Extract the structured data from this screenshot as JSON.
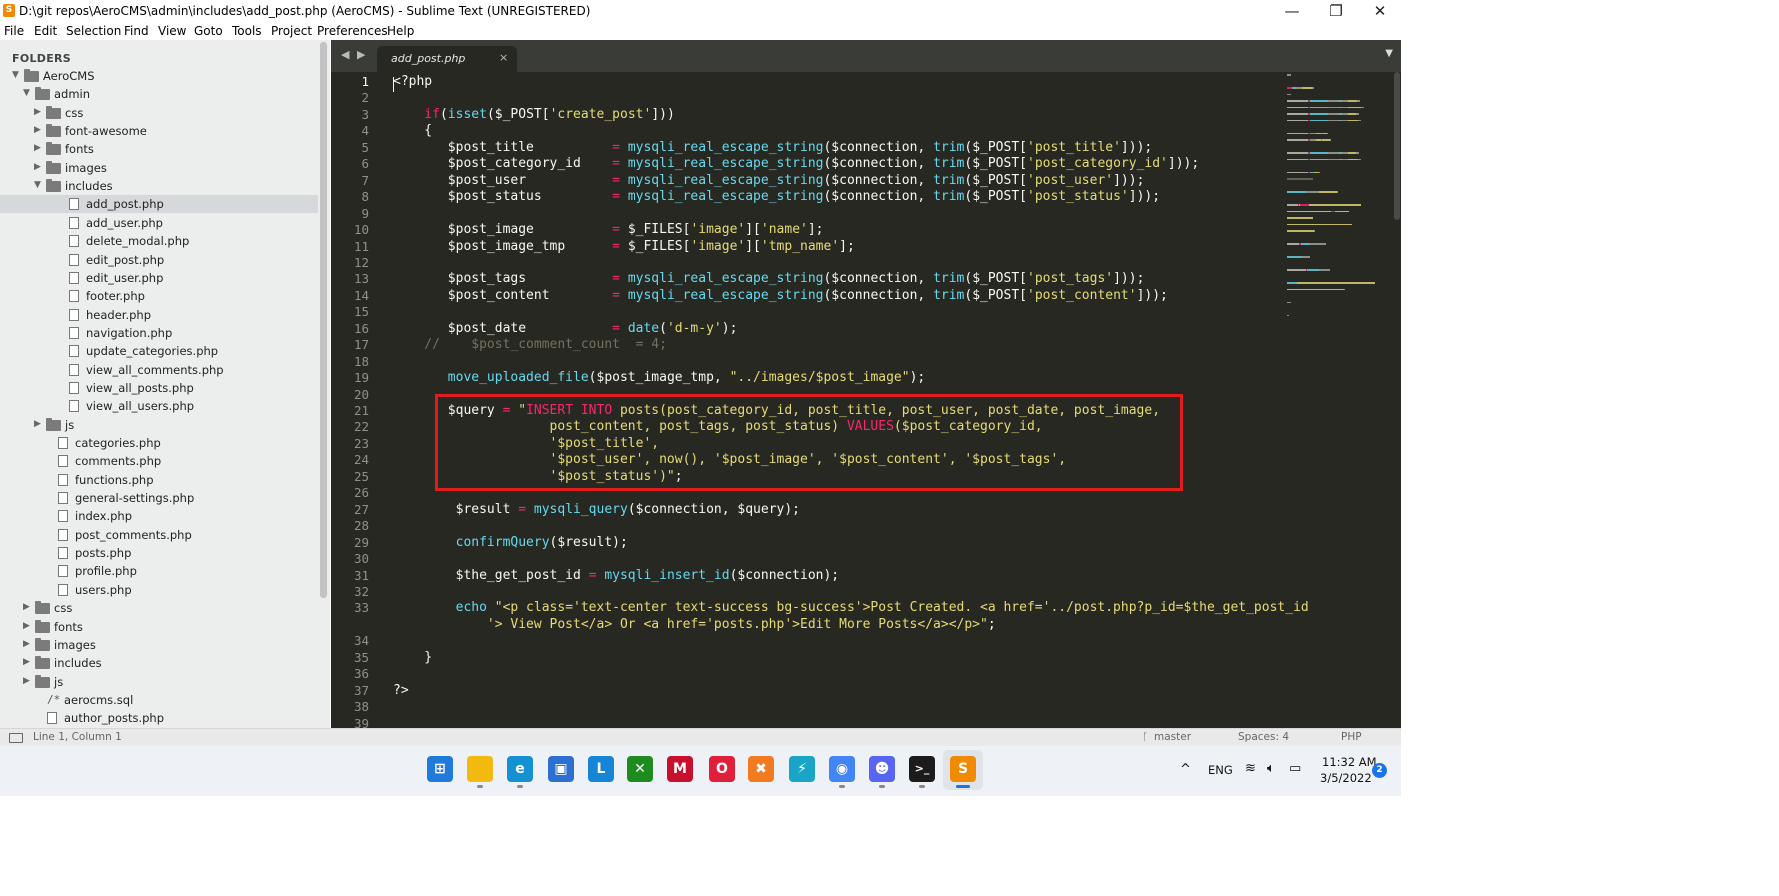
{
  "window": {
    "title": "D:\\git repos\\AeroCMS\\admin\\includes\\add_post.php (AeroCMS) - Sublime Text (UNREGISTERED)",
    "app_icon": "sublime-text-icon",
    "controls": {
      "minimize": "—",
      "maximize": "❐",
      "close": "✕"
    }
  },
  "menu": [
    "File",
    "Edit",
    "Selection",
    "Find",
    "View",
    "Goto",
    "Tools",
    "Project",
    "Preferences",
    "Help"
  ],
  "sidebar": {
    "header": "FOLDERS",
    "tree": [
      {
        "label": "AeroCMS",
        "type": "folder",
        "open": true
      },
      {
        "label": "admin",
        "type": "folder",
        "open": true
      },
      {
        "label": "css",
        "type": "folder",
        "open": false
      },
      {
        "label": "font-awesome",
        "type": "folder",
        "open": false
      },
      {
        "label": "fonts",
        "type": "folder",
        "open": false
      },
      {
        "label": "images",
        "type": "folder",
        "open": false
      },
      {
        "label": "includes",
        "type": "folder",
        "open": true
      },
      {
        "label": "add_post.php",
        "type": "file",
        "selected": true
      },
      {
        "label": "add_user.php",
        "type": "file"
      },
      {
        "label": "delete_modal.php",
        "type": "file"
      },
      {
        "label": "edit_post.php",
        "type": "file"
      },
      {
        "label": "edit_user.php",
        "type": "file"
      },
      {
        "label": "footer.php",
        "type": "file"
      },
      {
        "label": "header.php",
        "type": "file"
      },
      {
        "label": "navigation.php",
        "type": "file"
      },
      {
        "label": "update_categories.php",
        "type": "file"
      },
      {
        "label": "view_all_comments.php",
        "type": "file"
      },
      {
        "label": "view_all_posts.php",
        "type": "file"
      },
      {
        "label": "view_all_users.php",
        "type": "file"
      },
      {
        "label": "js",
        "type": "folder",
        "open": false
      },
      {
        "label": "categories.php",
        "type": "file"
      },
      {
        "label": "comments.php",
        "type": "file"
      },
      {
        "label": "functions.php",
        "type": "file"
      },
      {
        "label": "general-settings.php",
        "type": "file"
      },
      {
        "label": "index.php",
        "type": "file"
      },
      {
        "label": "post_comments.php",
        "type": "file"
      },
      {
        "label": "posts.php",
        "type": "file"
      },
      {
        "label": "profile.php",
        "type": "file"
      },
      {
        "label": "users.php",
        "type": "file"
      },
      {
        "label": "css",
        "type": "folder",
        "open": false
      },
      {
        "label": "fonts",
        "type": "folder",
        "open": false
      },
      {
        "label": "images",
        "type": "folder",
        "open": false
      },
      {
        "label": "includes",
        "type": "folder",
        "open": false
      },
      {
        "label": "js",
        "type": "folder",
        "open": false
      },
      {
        "label": "aerocms.sql",
        "type": "sql"
      },
      {
        "label": "author_posts.php",
        "type": "file"
      }
    ]
  },
  "editor": {
    "tab": {
      "label": "add_post.php",
      "close": "×",
      "nav": "◀ ▶",
      "dropdown": "▼"
    },
    "current_line": 1,
    "lines": [
      {
        "n": "1",
        "segs": [
          [
            "p",
            "<?php"
          ]
        ]
      },
      {
        "n": "2",
        "segs": []
      },
      {
        "n": "3",
        "segs": [
          [
            "k",
            "    if"
          ],
          [
            "p",
            "("
          ],
          [
            "f",
            "isset"
          ],
          [
            "p",
            "($_POST["
          ],
          [
            "s",
            "'create_post'"
          ],
          [
            "p",
            "]))"
          ]
        ]
      },
      {
        "n": "4",
        "segs": [
          [
            "p",
            "    {"
          ]
        ]
      },
      {
        "n": "5",
        "segs": [
          [
            "v",
            "       $post_title          "
          ],
          [
            "k",
            "= "
          ],
          [
            "f",
            "mysqli_real_escape_string"
          ],
          [
            "p",
            "($connection, "
          ],
          [
            "f",
            "trim"
          ],
          [
            "p",
            "($_POST["
          ],
          [
            "s",
            "'post_title'"
          ],
          [
            "p",
            "]));"
          ]
        ]
      },
      {
        "n": "6",
        "segs": [
          [
            "v",
            "       $post_category_id    "
          ],
          [
            "k",
            "= "
          ],
          [
            "f",
            "mysqli_real_escape_string"
          ],
          [
            "p",
            "($connection, "
          ],
          [
            "f",
            "trim"
          ],
          [
            "p",
            "($_POST["
          ],
          [
            "s",
            "'post_category_id'"
          ],
          [
            "p",
            "]));"
          ]
        ]
      },
      {
        "n": "7",
        "segs": [
          [
            "v",
            "       $post_user           "
          ],
          [
            "k",
            "= "
          ],
          [
            "f",
            "mysqli_real_escape_string"
          ],
          [
            "p",
            "($connection, "
          ],
          [
            "f",
            "trim"
          ],
          [
            "p",
            "($_POST["
          ],
          [
            "s",
            "'post_user'"
          ],
          [
            "p",
            "]));"
          ]
        ]
      },
      {
        "n": "8",
        "segs": [
          [
            "v",
            "       $post_status         "
          ],
          [
            "k",
            "= "
          ],
          [
            "f",
            "mysqli_real_escape_string"
          ],
          [
            "p",
            "($connection, "
          ],
          [
            "f",
            "trim"
          ],
          [
            "p",
            "($_POST["
          ],
          [
            "s",
            "'post_status'"
          ],
          [
            "p",
            "]));"
          ]
        ]
      },
      {
        "n": "9",
        "segs": []
      },
      {
        "n": "10",
        "segs": [
          [
            "v",
            "       $post_image          "
          ],
          [
            "k",
            "= "
          ],
          [
            "p",
            "$_FILES["
          ],
          [
            "s",
            "'image'"
          ],
          [
            "p",
            "]["
          ],
          [
            "s",
            "'name'"
          ],
          [
            "p",
            "];"
          ]
        ]
      },
      {
        "n": "11",
        "segs": [
          [
            "v",
            "       $post_image_tmp      "
          ],
          [
            "k",
            "= "
          ],
          [
            "p",
            "$_FILES["
          ],
          [
            "s",
            "'image'"
          ],
          [
            "p",
            "]["
          ],
          [
            "s",
            "'tmp_name'"
          ],
          [
            "p",
            "];"
          ]
        ]
      },
      {
        "n": "12",
        "segs": []
      },
      {
        "n": "13",
        "segs": [
          [
            "v",
            "       $post_tags           "
          ],
          [
            "k",
            "= "
          ],
          [
            "f",
            "mysqli_real_escape_string"
          ],
          [
            "p",
            "($connection, "
          ],
          [
            "f",
            "trim"
          ],
          [
            "p",
            "($_POST["
          ],
          [
            "s",
            "'post_tags'"
          ],
          [
            "p",
            "]));"
          ]
        ]
      },
      {
        "n": "14",
        "segs": [
          [
            "v",
            "       $post_content        "
          ],
          [
            "k",
            "= "
          ],
          [
            "f",
            "mysqli_real_escape_string"
          ],
          [
            "p",
            "($connection, "
          ],
          [
            "f",
            "trim"
          ],
          [
            "p",
            "($_POST["
          ],
          [
            "s",
            "'post_content'"
          ],
          [
            "p",
            "]));"
          ]
        ]
      },
      {
        "n": "15",
        "segs": []
      },
      {
        "n": "16",
        "segs": [
          [
            "v",
            "       $post_date           "
          ],
          [
            "k",
            "= "
          ],
          [
            "f",
            "date"
          ],
          [
            "p",
            "("
          ],
          [
            "s",
            "'d-m-y'"
          ],
          [
            "p",
            ");"
          ]
        ]
      },
      {
        "n": "17",
        "segs": [
          [
            "c",
            "    //    $post_comment_count  = 4;"
          ]
        ]
      },
      {
        "n": "18",
        "segs": []
      },
      {
        "n": "19",
        "segs": [
          [
            "f",
            "       move_uploaded_file"
          ],
          [
            "p",
            "($post_image_tmp, "
          ],
          [
            "s",
            "\"../images/$post_image\""
          ],
          [
            "p",
            ");"
          ]
        ]
      },
      {
        "n": "20",
        "segs": []
      },
      {
        "n": "21",
        "segs": [
          [
            "v",
            "       $query "
          ],
          [
            "k",
            "= "
          ],
          [
            "s",
            "\""
          ],
          [
            "k",
            "INSERT INTO "
          ],
          [
            "s",
            "posts(post_category_id, post_title, post_user, post_date, post_image,"
          ]
        ]
      },
      {
        "n": "22",
        "segs": [
          [
            "s",
            "                    post_content, post_tags, post_status) "
          ],
          [
            "k",
            "VALUES"
          ],
          [
            "s",
            "($post_category_id,"
          ]
        ]
      },
      {
        "n": "23",
        "segs": [
          [
            "s",
            "                    '$post_title',"
          ]
        ]
      },
      {
        "n": "24",
        "segs": [
          [
            "s",
            "                    '$post_user', now(), '$post_image', '$post_content', '$post_tags',"
          ]
        ]
      },
      {
        "n": "25",
        "segs": [
          [
            "s",
            "                    '$post_status')\""
          ],
          [
            "p",
            ";"
          ]
        ]
      },
      {
        "n": "26",
        "segs": []
      },
      {
        "n": "27",
        "segs": [
          [
            "v",
            "        $result "
          ],
          [
            "k",
            "= "
          ],
          [
            "f",
            "mysqli_query"
          ],
          [
            "p",
            "($connection, $query);"
          ]
        ]
      },
      {
        "n": "28",
        "segs": []
      },
      {
        "n": "29",
        "segs": [
          [
            "f",
            "        confirmQuery"
          ],
          [
            "p",
            "($result);"
          ]
        ]
      },
      {
        "n": "30",
        "segs": []
      },
      {
        "n": "31",
        "segs": [
          [
            "v",
            "        $the_get_post_id "
          ],
          [
            "k",
            "= "
          ],
          [
            "f",
            "mysqli_insert_id"
          ],
          [
            "p",
            "($connection);"
          ]
        ]
      },
      {
        "n": "32",
        "segs": []
      },
      {
        "n": "33",
        "segs": [
          [
            "f",
            "        echo "
          ],
          [
            "s",
            "\"<p class='text-center text-success bg-success'>Post Created. <a href='../post.php?p_id=$the_get_post_id"
          ]
        ]
      },
      {
        "n": "",
        "segs": [
          [
            "s",
            "            '> View Post</a> Or <a href='posts.php'>Edit More Posts</a></p>\""
          ],
          [
            "p",
            ";"
          ]
        ]
      },
      {
        "n": "34",
        "segs": []
      },
      {
        "n": "35",
        "segs": [
          [
            "p",
            "    }"
          ]
        ]
      },
      {
        "n": "36",
        "segs": []
      },
      {
        "n": "37",
        "segs": [
          [
            "p",
            "?>"
          ]
        ]
      },
      {
        "n": "38",
        "segs": []
      },
      {
        "n": "39",
        "segs": []
      }
    ]
  },
  "statusbar": {
    "position": "Line 1, Column 1",
    "branch": "master",
    "spaces": "Spaces: 4",
    "syntax": "PHP"
  },
  "taskbar": {
    "apps": [
      {
        "name": "windows-start-icon",
        "color": "#1f7adb",
        "glyph": "⊞"
      },
      {
        "name": "file-explorer-icon",
        "color": "#f2b90f",
        "glyph": ""
      },
      {
        "name": "edge-icon",
        "color": "#1591d3",
        "glyph": "e"
      },
      {
        "name": "store-icon",
        "color": "#2d6fd1",
        "glyph": "▣"
      },
      {
        "name": "l-app-icon",
        "color": "#1685d8",
        "glyph": "L"
      },
      {
        "name": "xbox-icon",
        "color": "#1e8b1e",
        "glyph": "✕"
      },
      {
        "name": "mcafee-icon",
        "color": "#c8102e",
        "glyph": "M"
      },
      {
        "name": "opera-icon",
        "color": "#e0203a",
        "glyph": "O"
      },
      {
        "name": "xampp-icon",
        "color": "#f27b22",
        "glyph": "✖"
      },
      {
        "name": "bolt-app-icon",
        "color": "#1aa5c7",
        "glyph": "⚡"
      },
      {
        "name": "chrome-icon",
        "color": "#4285f4",
        "glyph": "◉"
      },
      {
        "name": "discord-icon",
        "color": "#5865f2",
        "glyph": "☻"
      },
      {
        "name": "terminal-icon",
        "color": "#1b1b1b",
        "glyph": ">_"
      },
      {
        "name": "sublime-text-icon",
        "color": "#f08a00",
        "glyph": "S"
      }
    ],
    "tray": {
      "chevron": "^",
      "lang": "ENG",
      "wifi": "wifi-icon",
      "volume": "volume-icon",
      "battery": "battery-icon",
      "time": "11:32 AM",
      "date": "3/5/2022",
      "notifications": "2"
    }
  }
}
